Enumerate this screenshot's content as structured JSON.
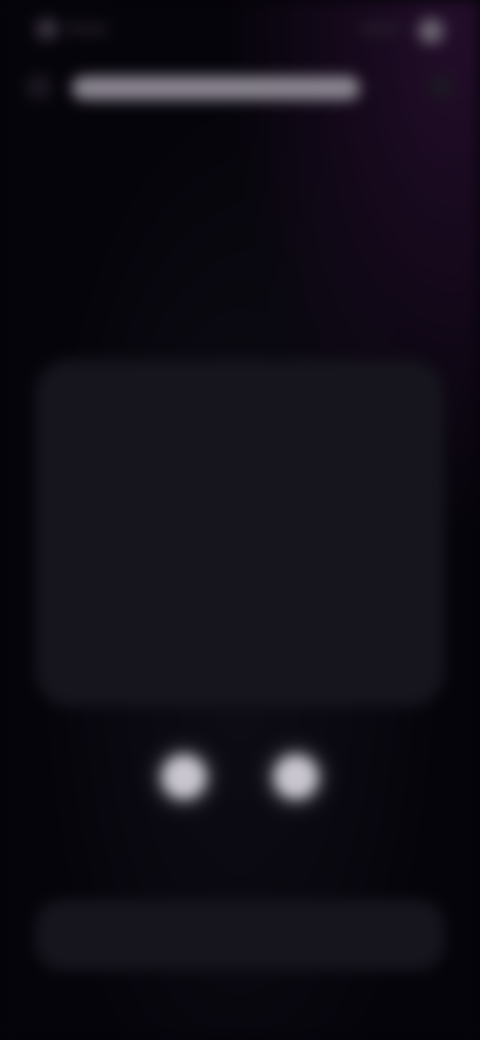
{
  "status_bar": {
    "left_icon": "status-dot-icon",
    "right_icon": "profile-dot-icon"
  },
  "nav": {
    "back_icon": "back-icon",
    "menu_icon": "menu-icon",
    "url_bar": ""
  },
  "header": {
    "title_line_1": "",
    "title_line_2": ""
  },
  "preview": {
    "label": ""
  },
  "controls": {
    "left_icon": "record-dot-icon",
    "right_icon": "record-dot-icon"
  },
  "primary_action": {
    "label": ""
  },
  "colors": {
    "background": "#06040b",
    "card": "#16151d",
    "glow": "#c9c6cf",
    "accent": "#5a1e64"
  }
}
